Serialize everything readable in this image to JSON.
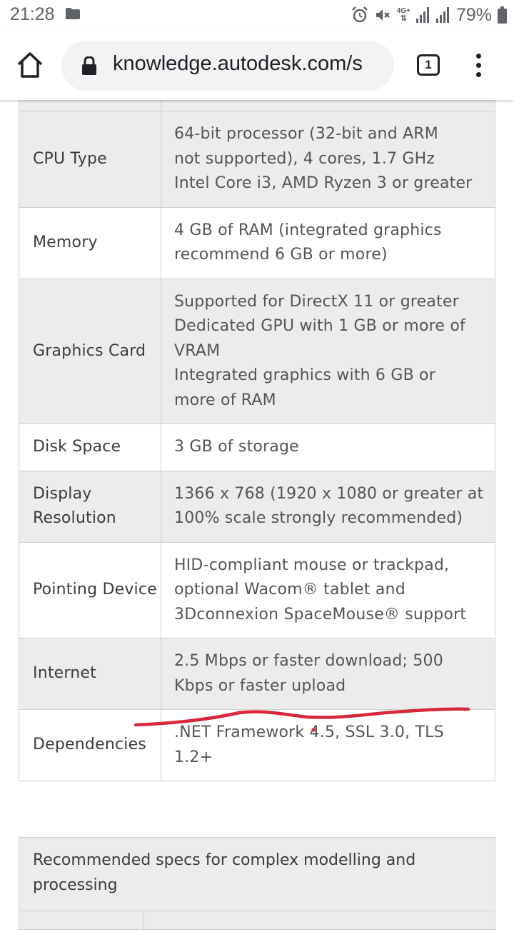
{
  "status_bar": {
    "time": "21:28",
    "network": "4G+",
    "battery": "79%"
  },
  "browser": {
    "url": "knowledge.autodesk.com/s",
    "tab_count": "1"
  },
  "specs": [
    {
      "label": "CPU Type",
      "value_lines": [
        "64-bit processor (32-bit and ARM",
        "not supported), 4 cores, 1.7 GHz",
        "Intel Core i3, AMD Ryzen 3 or greater"
      ],
      "shaded": true
    },
    {
      "label": "Memory",
      "value_lines": [
        "4 GB of RAM (integrated graphics",
        "recommend 6 GB or more)"
      ],
      "shaded": false
    },
    {
      "label": "Graphics Card",
      "value_lines": [
        "Supported for DirectX 11 or greater",
        "Dedicated GPU with 1 GB or more of",
        "VRAM",
        "Integrated graphics with 6 GB or",
        "more of RAM"
      ],
      "shaded": true
    },
    {
      "label": "Disk Space",
      "value_lines": [
        "3 GB of storage"
      ],
      "shaded": false
    },
    {
      "label": "Display Resolution",
      "value_lines": [
        "1366 x 768 (1920 x 1080 or greater at",
        "100% scale strongly recommended)"
      ],
      "shaded": true
    },
    {
      "label": "Pointing Device",
      "value_lines": [
        "HID-compliant mouse or trackpad,",
        "optional Wacom® tablet and",
        "3Dconnexion SpaceMouse® support"
      ],
      "shaded": false
    },
    {
      "label": "Internet",
      "value_lines": [
        "2.5 Mbps or faster download; 500",
        "Kbps or faster upload"
      ],
      "shaded": true
    },
    {
      "label": "Dependencies",
      "value_lines": [
        ".NET Framework 4.5, SSL 3.0, TLS",
        "1.2+"
      ],
      "shaded": false
    }
  ],
  "recommended": {
    "title": "Recommended specs for complex modelling and processing"
  },
  "annotation": {
    "stroke_color": "#d9263a"
  }
}
